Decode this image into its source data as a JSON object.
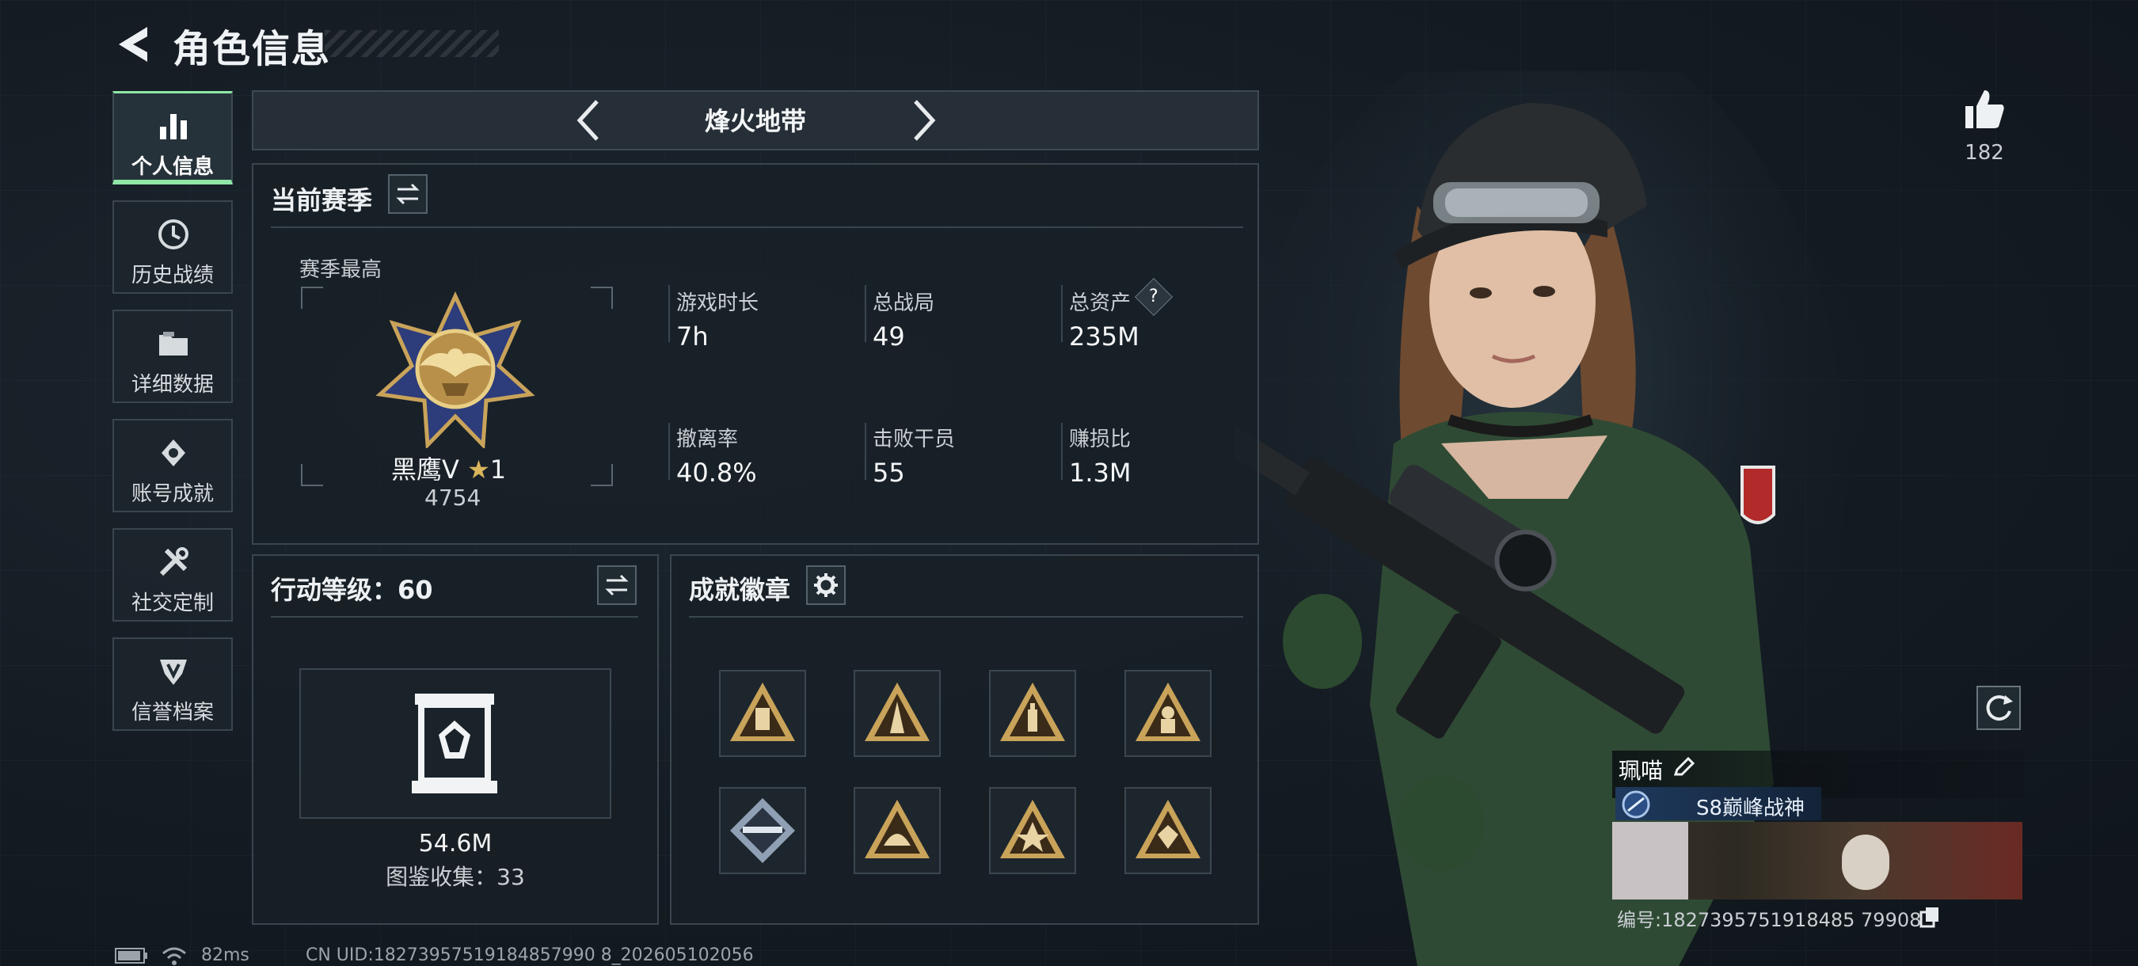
{
  "header": {
    "title": "角色信息"
  },
  "sidebar": {
    "items": [
      {
        "label": "个人信息",
        "icon": "bar-chart-icon",
        "active": true
      },
      {
        "label": "历史战绩",
        "icon": "history-icon",
        "active": false
      },
      {
        "label": "详细数据",
        "icon": "folder-icon",
        "active": false
      },
      {
        "label": "账号成就",
        "icon": "achievement-icon",
        "active": false
      },
      {
        "label": "社交定制",
        "icon": "tools-icon",
        "active": false
      },
      {
        "label": "信誉档案",
        "icon": "shield-icon",
        "active": false
      }
    ]
  },
  "map_selector": {
    "current": "烽火地带"
  },
  "season": {
    "title": "当前赛季",
    "best_label": "赛季最高",
    "rank_name": "黑鹰V",
    "rank_stars": "1",
    "rank_score": "4754",
    "stats": [
      {
        "label": "游戏时长",
        "value": "7h"
      },
      {
        "label": "总战局",
        "value": "49"
      },
      {
        "label": "总资产",
        "value": "235M",
        "help": "?"
      },
      {
        "label": "撤离率",
        "value": "40.8%"
      },
      {
        "label": "击败干员",
        "value": "55"
      },
      {
        "label": "赚损比",
        "value": "1.3M"
      }
    ]
  },
  "action_level": {
    "title": "行动等级：60",
    "asset_value": "54.6M",
    "collection": "图鉴收集：33"
  },
  "achievements": {
    "title": "成就徽章",
    "badges": [
      "lantern-badge-icon",
      "tower-badge-icon",
      "bottle-badge-icon",
      "soldier-badge-icon",
      "rifle-badge-icon",
      "helmet-badge-icon",
      "explosion-badge-icon",
      "gem-badge-icon"
    ]
  },
  "likes": {
    "count": "182"
  },
  "character": {
    "name": "珮喵",
    "title": "S8巅峰战神",
    "id": "编号:1827395751918485 79908"
  },
  "status_bar": {
    "ping": "82ms",
    "uid": "CN UID:18273957519184857990 8_202605102056"
  },
  "colors": {
    "accent": "#8fe6a6",
    "panel_border": "#3a454d",
    "gold": "#c9a35a"
  }
}
